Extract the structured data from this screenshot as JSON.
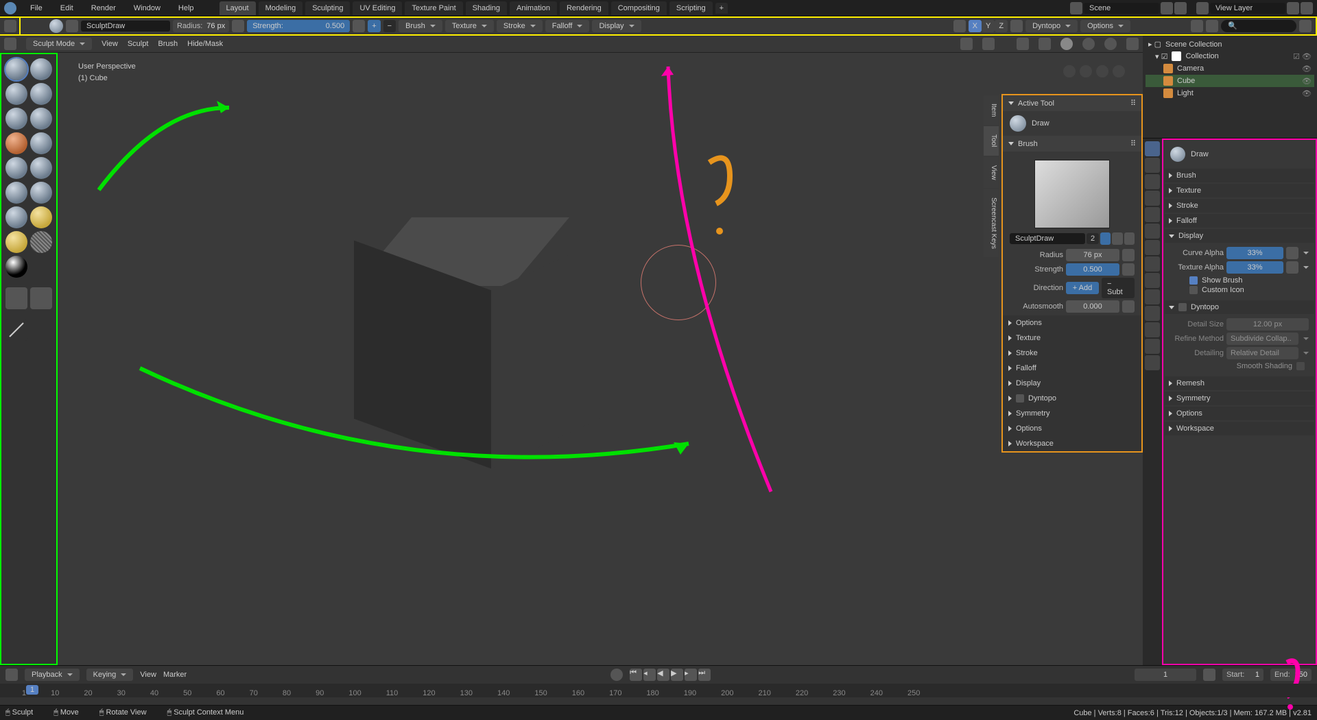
{
  "topbar": {
    "menus": [
      "File",
      "Edit",
      "Render",
      "Window",
      "Help"
    ],
    "tabs": [
      "Layout",
      "Modeling",
      "Sculpting",
      "UV Editing",
      "Texture Paint",
      "Shading",
      "Animation",
      "Rendering",
      "Compositing",
      "Scripting"
    ],
    "active_tab": "Layout",
    "scene_label": "Scene",
    "layer_label": "View Layer"
  },
  "toolheader": {
    "brush_name": "SculptDraw",
    "radius_label": "Radius:",
    "radius_value": "76 px",
    "strength_label": "Strength:",
    "strength_value": "0.500",
    "dropdowns": [
      "Brush",
      "Texture",
      "Stroke",
      "Falloff",
      "Display"
    ],
    "dyntopo": "Dyntopo",
    "options": "Options",
    "xyz": [
      "X",
      "Y",
      "Z"
    ]
  },
  "viewbar": {
    "mode": "Sculpt Mode",
    "menus": [
      "View",
      "Sculpt",
      "Brush",
      "Hide/Mask"
    ]
  },
  "hud": {
    "line1": "User Perspective",
    "line2": "(1) Cube"
  },
  "np": {
    "active_tool_h": "Active Tool",
    "draw": "Draw",
    "brush_h": "Brush",
    "brush_name": "SculptDraw",
    "brush_count": "2",
    "radius_lbl": "Radius",
    "radius_val": "76 px",
    "strength_lbl": "Strength",
    "strength_val": "0.500",
    "direction_lbl": "Direction",
    "direction_add": "+ Add",
    "direction_subt": "− Subt",
    "autosmooth_lbl": "Autosmooth",
    "autosmooth_val": "0.000",
    "options": "Options",
    "sections": [
      "Texture",
      "Stroke",
      "Falloff",
      "Display",
      "Dyntopo",
      "Symmetry",
      "Options",
      "Workspace"
    ]
  },
  "vtabs": [
    "Item",
    "Tool",
    "View",
    "Screencast Keys"
  ],
  "outliner": {
    "root": "Scene Collection",
    "collection": "Collection",
    "items": [
      "Camera",
      "Cube",
      "Light"
    ]
  },
  "props": {
    "draw": "Draw",
    "sections_closed": [
      "Brush",
      "Texture",
      "Stroke",
      "Falloff"
    ],
    "display_h": "Display",
    "curve_alpha_lbl": "Curve Alpha",
    "curve_alpha_val": "33%",
    "tex_alpha_lbl": "Texture Alpha",
    "tex_alpha_val": "33%",
    "show_brush": "Show Brush",
    "custom_icon": "Custom Icon",
    "dyntopo_h": "Dyntopo",
    "detail_size_lbl": "Detail Size",
    "detail_size_val": "12.00 px",
    "refine_lbl": "Refine Method",
    "refine_val": "Subdivide Collap..",
    "detailing_lbl": "Detailing",
    "detailing_val": "Relative Detail",
    "smooth_shading": "Smooth Shading",
    "remesh": "Remesh",
    "tail": [
      "Symmetry",
      "Options",
      "Workspace"
    ]
  },
  "timeline": {
    "menus": [
      "Playback",
      "Keying",
      "View",
      "Marker"
    ],
    "start_lbl": "Start:",
    "start_val": "1",
    "end_lbl": "End:",
    "end_val": "250",
    "cur": "1",
    "frame_field": "1",
    "ticks": [
      "1",
      "10",
      "20",
      "30",
      "40",
      "50",
      "60",
      "70",
      "80",
      "90",
      "100",
      "110",
      "120",
      "130",
      "140",
      "150",
      "160",
      "170",
      "180",
      "190",
      "200",
      "210",
      "220",
      "230",
      "240",
      "250"
    ]
  },
  "status": {
    "left1": "Sculpt",
    "left2": "Move",
    "mid1": "Rotate View",
    "mid2": "Sculpt Context Menu",
    "right": "Cube | Verts:8 | Faces:6 | Tris:12 | Objects:1/3 | Mem: 167.2 MB | v2.81"
  },
  "search_ph": "🔍"
}
